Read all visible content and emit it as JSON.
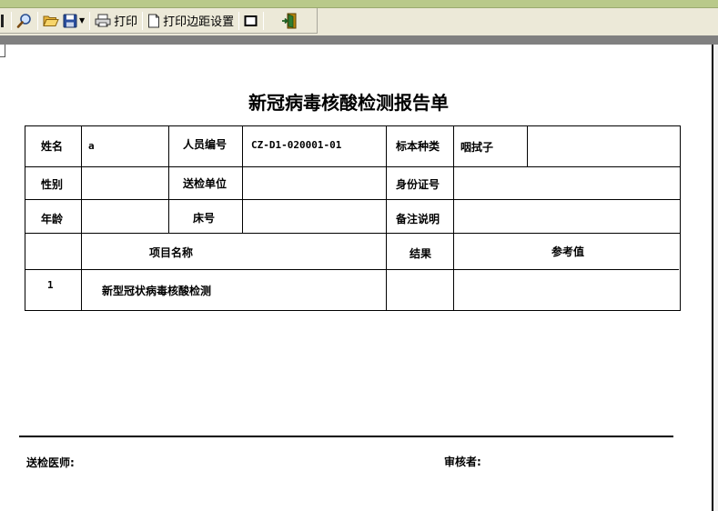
{
  "toolbar": {
    "print_label": "打印",
    "margin_label": "打印边距设置"
  },
  "report": {
    "title": "新冠病毒核酸检测报告单",
    "fields": {
      "name_label": "姓名",
      "name_value": "a",
      "person_id_label": "人员编号",
      "person_id_value": "CZ-D1-020001-01",
      "specimen_type_label": "标本种类",
      "specimen_type_value": "咽拭子",
      "gender_label": "性别",
      "dept_label": "送检单位",
      "id_card_label": "身份证号",
      "age_label": "年龄",
      "bed_label": "床号",
      "remark_label": "备注说明"
    },
    "results_header": {
      "item_name": "项目名称",
      "result": "结果",
      "reference": "参考值"
    },
    "rows": [
      {
        "index": "1",
        "item": "新型冠状病毒核酸检测",
        "result": "",
        "reference": ""
      }
    ],
    "footer": {
      "doctor_label": "送检医师:",
      "reviewer_label": "审核者:"
    }
  }
}
